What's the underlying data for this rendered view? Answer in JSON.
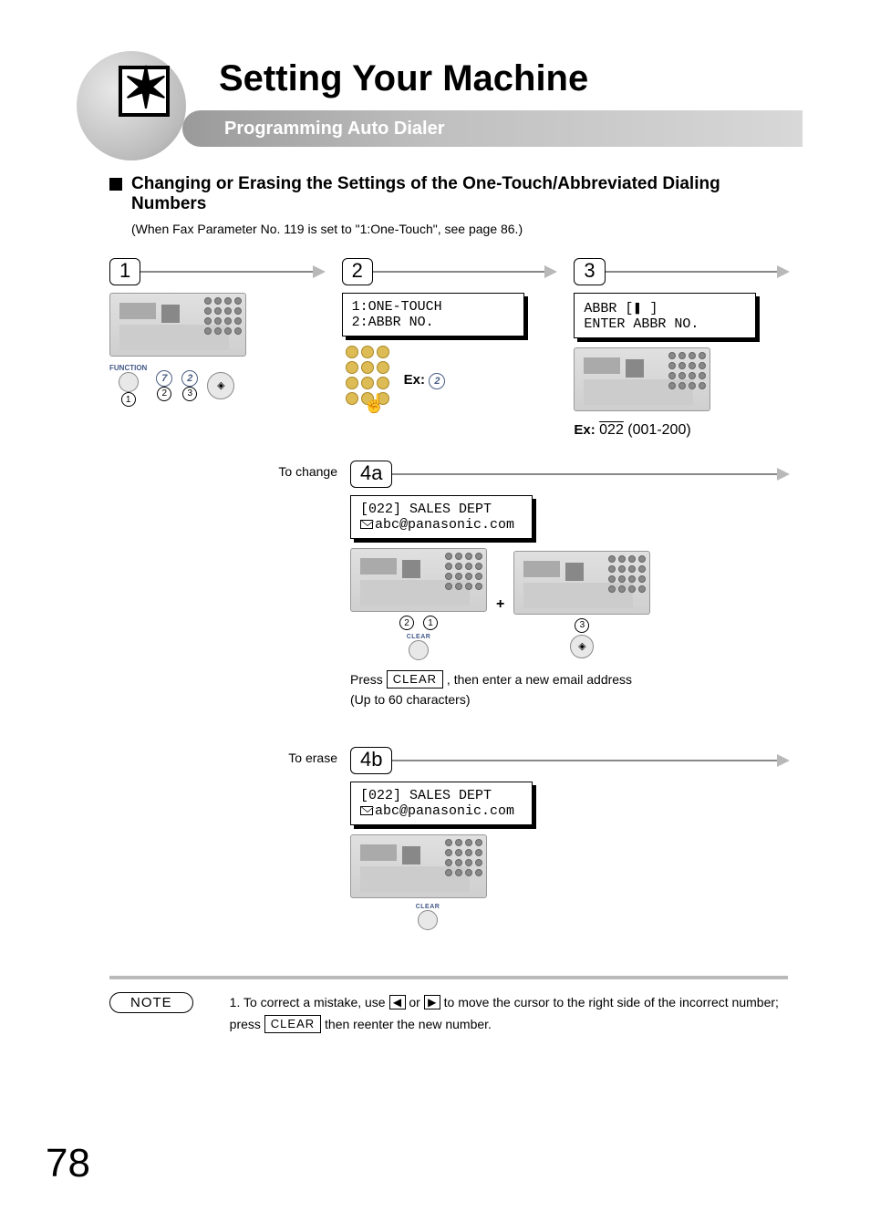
{
  "header": {
    "title": "Setting Your Machine",
    "subtitle": "Programming Auto Dialer"
  },
  "section": {
    "heading": "Changing or Erasing the Settings of the One-Touch/Abbreviated Dialing Numbers",
    "subnote": "(When Fax Parameter No. 119 is set to \"1:One-Touch\", see page 86.)"
  },
  "steps": {
    "s1": {
      "num": "1",
      "function_label": "FUNCTION",
      "btn7": "7",
      "btn2": "2",
      "seq1": "1",
      "seq2": "2",
      "seq3": "3"
    },
    "s2": {
      "num": "2",
      "lcd_line1": "1:ONE-TOUCH",
      "lcd_line2": "2:ABBR NO.",
      "ex_label": "Ex:",
      "ex_value": "2"
    },
    "s3": {
      "num": "3",
      "lcd_line1": "ABBR [❚ ]",
      "lcd_line2": "ENTER ABBR NO.",
      "ex_label": "Ex:",
      "ex_value": "022",
      "ex_range": "(001-200)"
    },
    "s4a": {
      "side": "To change",
      "num": "4a",
      "lcd_line1": "[022] SALES DEPT",
      "lcd_email": "abc@panasonic.com",
      "clear_label": "CLEAR",
      "press_a": "Press ",
      "press_key": "CLEAR",
      "press_b": " , then enter a new email address",
      "press_c": "(Up to 60 characters)",
      "seq1": "1",
      "seq2": "2",
      "seq3": "3"
    },
    "s4b": {
      "side": "To erase",
      "num": "4b",
      "lcd_line1": "[022] SALES DEPT",
      "lcd_email": "abc@panasonic.com",
      "clear_label": "CLEAR"
    }
  },
  "note": {
    "label": "NOTE",
    "text_a": "1. To correct a mistake, use ",
    "text_b": " or ",
    "text_c": " to move the cursor to the right side of the incorrect number; press ",
    "key_clear": "CLEAR",
    "text_d": " then reenter the new number."
  },
  "page_number": "78"
}
